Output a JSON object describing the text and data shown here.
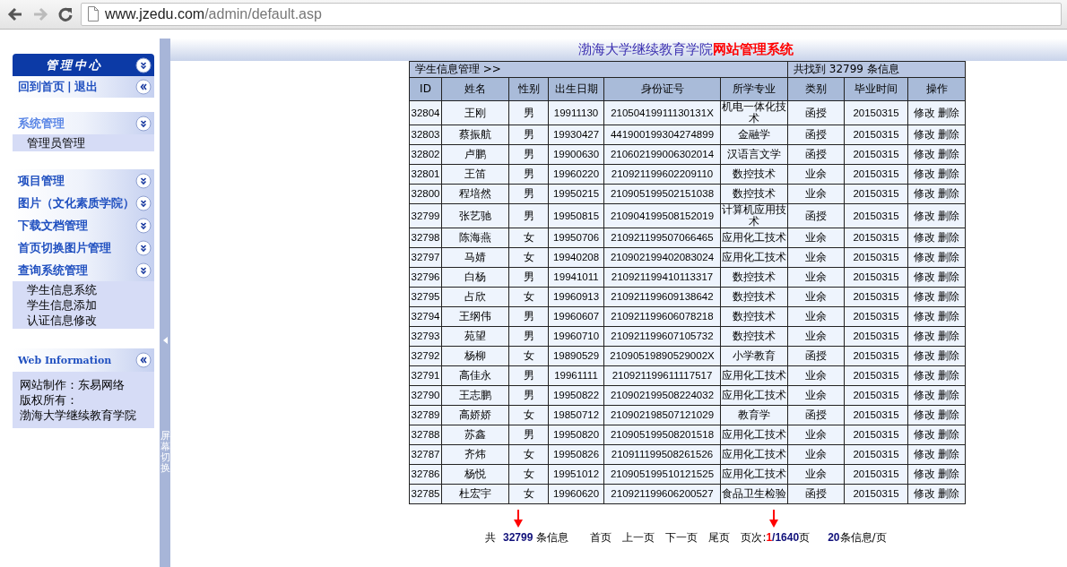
{
  "browser": {
    "back_enabled": true,
    "forward_enabled": false,
    "address": {
      "host": "www.jzedu.com",
      "path": "/admin/default.asp"
    }
  },
  "sidebar": {
    "title": "管理中心",
    "top_links": [
      "回到首页",
      "|",
      "退出"
    ],
    "groups": [
      {
        "sections": [
          {
            "title": "系统管理",
            "selected": true,
            "items": [
              "管理员管理"
            ]
          }
        ]
      },
      {
        "sections": [
          {
            "title": "项目管理",
            "selected": false
          },
          {
            "title": "图片（文化素质学院）",
            "selected": false
          },
          {
            "title": "下载文档管理",
            "selected": false
          },
          {
            "title": "首页切换图片管理",
            "selected": false
          },
          {
            "title": "查询系统管理",
            "selected": false,
            "items": [
              "学生信息系统",
              "学生信息添加",
              "认证信息修改"
            ]
          }
        ]
      }
    ],
    "info": {
      "title": "Web Information",
      "lines": [
        "网站制作：东易网络",
        "版权所有：",
        "渤海大学继续教育学院"
      ]
    }
  },
  "splitter": {
    "label": "屏幕切换"
  },
  "banner": {
    "title_start": "渤海大学继续教育学院",
    "title_end": "网站管理系统"
  },
  "table": {
    "caption_left": "学生信息管理 >>",
    "caption_right": "共找到 32799 条信息",
    "columns": [
      "ID",
      "姓名",
      "性别",
      "出生日期",
      "身份证号",
      "所学专业",
      "类别",
      "毕业时间",
      "操作"
    ],
    "rows": [
      {
        "cells": [
          "32804",
          "王刚",
          "男",
          "19911130",
          "21050419911130131X",
          "机电一体化技术",
          "函授",
          "20150315"
        ],
        "actions": [
          "修改",
          "删除"
        ]
      },
      {
        "cells": [
          "32803",
          "蔡振航",
          "男",
          "19930427",
          "441900199304274899",
          "金融学",
          "函授",
          "20150315"
        ],
        "actions": [
          "修改",
          "删除"
        ]
      },
      {
        "cells": [
          "32802",
          "卢鹏",
          "男",
          "19900630",
          "210602199006302014",
          "汉语言文学",
          "函授",
          "20150315"
        ],
        "actions": [
          "修改",
          "删除"
        ]
      },
      {
        "cells": [
          "32801",
          "王笛",
          "男",
          "19960220",
          "210921199602209110",
          "数控技术",
          "业余",
          "20150315"
        ],
        "actions": [
          "修改",
          "删除"
        ]
      },
      {
        "cells": [
          "32800",
          "程培然",
          "男",
          "19950215",
          "210905199502151038",
          "数控技术",
          "业余",
          "20150315"
        ],
        "actions": [
          "修改",
          "删除"
        ]
      },
      {
        "cells": [
          "32799",
          "张艺驰",
          "男",
          "19950815",
          "210904199508152019",
          "计算机应用技术",
          "函授",
          "20150315"
        ],
        "actions": [
          "修改",
          "删除"
        ]
      },
      {
        "cells": [
          "32798",
          "陈海燕",
          "女",
          "19950706",
          "210921199507066465",
          "应用化工技术",
          "业余",
          "20150315"
        ],
        "actions": [
          "修改",
          "删除"
        ]
      },
      {
        "cells": [
          "32797",
          "马婧",
          "女",
          "19940208",
          "210902199402083024",
          "应用化工技术",
          "业余",
          "20150315"
        ],
        "actions": [
          "修改",
          "删除"
        ]
      },
      {
        "cells": [
          "32796",
          "白杨",
          "男",
          "19941011",
          "210921199410113317",
          "数控技术",
          "业余",
          "20150315"
        ],
        "actions": [
          "修改",
          "删除"
        ]
      },
      {
        "cells": [
          "32795",
          "占欣",
          "女",
          "19960913",
          "210921199609138642",
          "数控技术",
          "业余",
          "20150315"
        ],
        "actions": [
          "修改",
          "删除"
        ]
      },
      {
        "cells": [
          "32794",
          "王纲伟",
          "男",
          "19960607",
          "210921199606078218",
          "数控技术",
          "业余",
          "20150315"
        ],
        "actions": [
          "修改",
          "删除"
        ]
      },
      {
        "cells": [
          "32793",
          "苑望",
          "男",
          "19960710",
          "210921199607105732",
          "数控技术",
          "业余",
          "20150315"
        ],
        "actions": [
          "修改",
          "删除"
        ]
      },
      {
        "cells": [
          "32792",
          "杨柳",
          "女",
          "19890529",
          "21090519890529002X",
          "小学教育",
          "函授",
          "20150315"
        ],
        "actions": [
          "修改",
          "删除"
        ]
      },
      {
        "cells": [
          "32791",
          "高佳永",
          "男",
          "19961111",
          "210921199611117517",
          "应用化工技术",
          "业余",
          "20150315"
        ],
        "actions": [
          "修改",
          "删除"
        ]
      },
      {
        "cells": [
          "32790",
          "王志鹏",
          "男",
          "19950822",
          "210902199508224032",
          "应用化工技术",
          "业余",
          "20150315"
        ],
        "actions": [
          "修改",
          "删除"
        ]
      },
      {
        "cells": [
          "32789",
          "高娇娇",
          "女",
          "19850712",
          "210902198507121029",
          "教育学",
          "函授",
          "20150315"
        ],
        "actions": [
          "修改",
          "删除"
        ]
      },
      {
        "cells": [
          "32788",
          "苏鑫",
          "男",
          "19950820",
          "210905199508201518",
          "应用化工技术",
          "业余",
          "20150315"
        ],
        "actions": [
          "修改",
          "删除"
        ]
      },
      {
        "cells": [
          "32787",
          "齐炜",
          "女",
          "19950826",
          "210911199508261526",
          "应用化工技术",
          "业余",
          "20150315"
        ],
        "actions": [
          "修改",
          "删除"
        ]
      },
      {
        "cells": [
          "32786",
          "杨悦",
          "女",
          "19951012",
          "210905199510121525",
          "应用化工技术",
          "业余",
          "20150315"
        ],
        "actions": [
          "修改",
          "删除"
        ]
      },
      {
        "cells": [
          "32785",
          "杜宏宇",
          "女",
          "19960620",
          "210921199606200527",
          "食品卫生检验",
          "函授",
          "20150315"
        ],
        "actions": [
          "修改",
          "删除"
        ]
      }
    ]
  },
  "pager": {
    "total_prefix": "共",
    "total": "32799",
    "total_suffix": "条信息",
    "links": [
      "首页",
      "上一页",
      "下一页",
      "尾页"
    ],
    "page_label": "页次:",
    "current": "1",
    "page_count": "/1640",
    "page_suffix": "页",
    "per_page": "20",
    "per_page_suffix": "条信息/页"
  },
  "annotations": [
    {
      "kind": "arrow"
    },
    {
      "kind": "arrow"
    }
  ]
}
